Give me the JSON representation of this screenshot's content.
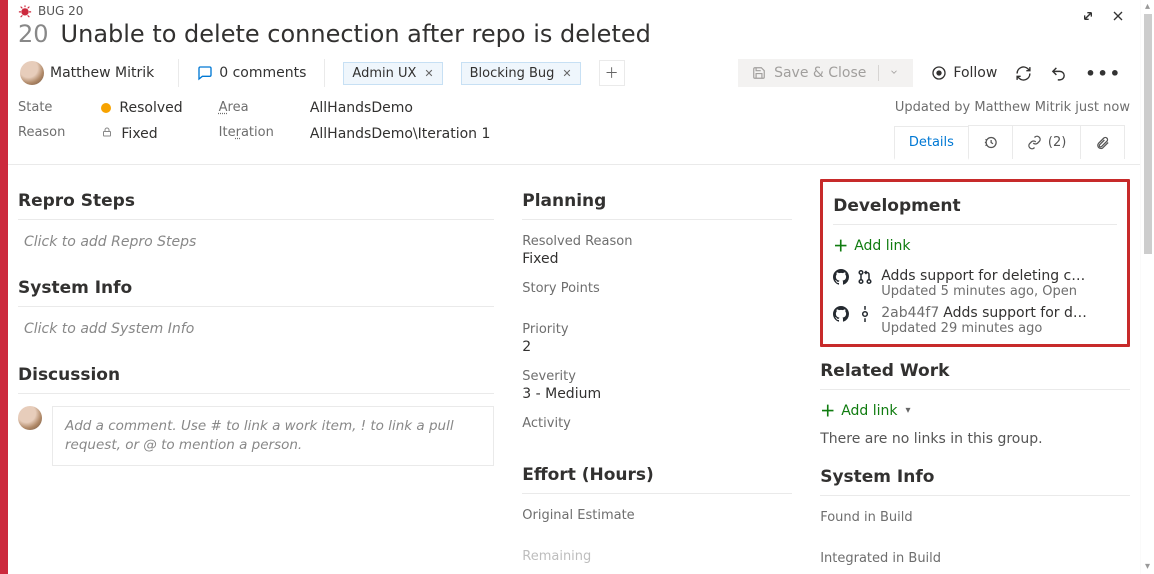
{
  "type_label": "BUG 20",
  "id": "20",
  "title": "Unable to delete connection after repo is deleted",
  "assignee": "Matthew Mitrik",
  "comments_label": "0 comments",
  "tags": [
    "Admin UX",
    "Blocking Bug"
  ],
  "save_label": "Save & Close",
  "follow_label": "Follow",
  "classification": {
    "state_label": "State",
    "state_value": "Resolved",
    "reason_label": "Reason",
    "reason_value": "Fixed",
    "area_label_html": "Area",
    "area_value": "AllHandsDemo",
    "iteration_label_html": "Iteration",
    "iteration_value": "AllHandsDemo\\Iteration 1",
    "updated_by": "Updated by Matthew Mitrik just now"
  },
  "tabs": {
    "details": "Details",
    "links_count": "(2)"
  },
  "left": {
    "repro_h": "Repro Steps",
    "repro_ph": "Click to add Repro Steps",
    "sys_h": "System Info",
    "sys_ph": "Click to add System Info",
    "disc_h": "Discussion",
    "disc_ph": "Add a comment. Use # to link a work item, ! to link a pull request, or @ to mention a person."
  },
  "mid": {
    "planning_h": "Planning",
    "resolved_reason_l": "Resolved Reason",
    "resolved_reason_v": "Fixed",
    "story_points_l": "Story Points",
    "priority_l": "Priority",
    "priority_v": "2",
    "severity_l": "Severity",
    "severity_v": "3 - Medium",
    "activity_l": "Activity",
    "effort_h": "Effort (Hours)",
    "original_estimate_l": "Original Estimate",
    "remaining_l": "Remaining"
  },
  "right": {
    "dev_h": "Development",
    "add_link": "Add link",
    "dev_items": [
      {
        "kind": "pr",
        "title": "Adds support for deleting connecti…",
        "sub": "Updated 5 minutes ago,  Open"
      },
      {
        "kind": "commit",
        "hash": "2ab44f7",
        "title": "Adds support for deleting …",
        "sub": "Updated 29 minutes ago"
      }
    ],
    "related_h": "Related Work",
    "related_empty": "There are no links in this group.",
    "sysinfo_h": "System Info",
    "found_l": "Found in Build",
    "integrated_l": "Integrated in Build"
  }
}
